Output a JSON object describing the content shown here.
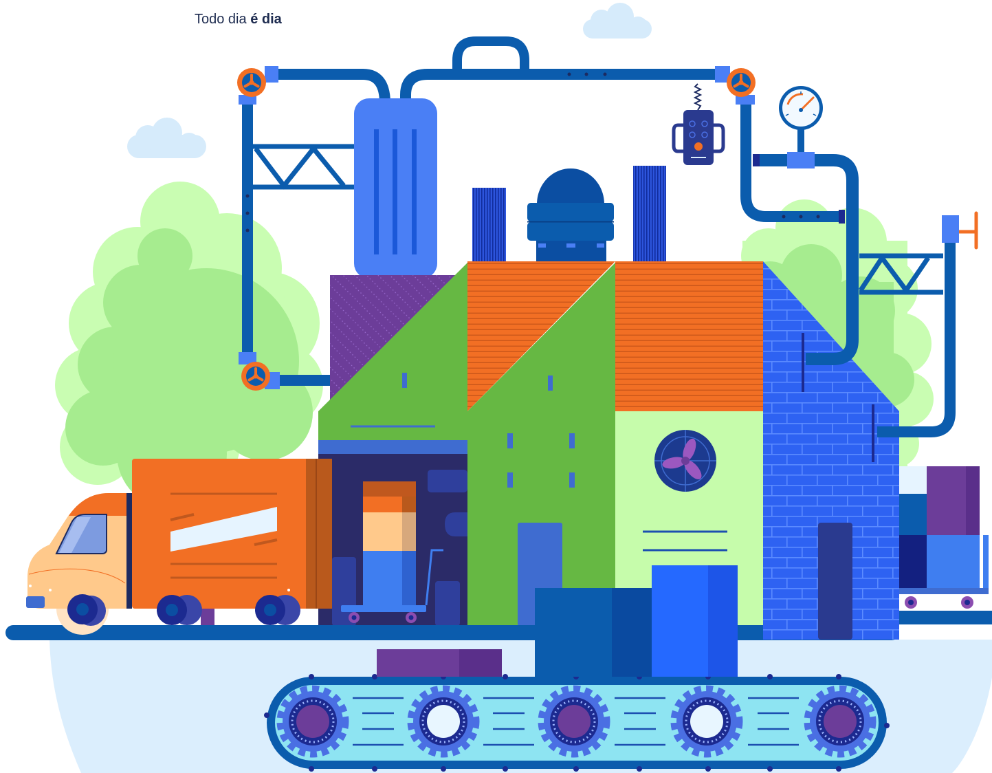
{
  "headline": {
    "regular": "Todo dia",
    "bold": "é dia"
  },
  "colors": {
    "pipe_blue": "#0b5cad",
    "accent_orange": "#f26f24",
    "building_green": "#66b843",
    "light_green": "#c6fcab",
    "purple": "#6c3d99",
    "brick_blue": "#2e62f2",
    "ground_blue": "#dbeefd",
    "text": "#1d2b4f"
  },
  "icons": [
    "valve-icon",
    "pressure-gauge-icon",
    "robot-claw-icon",
    "fan-icon",
    "gear-icon",
    "truck-icon",
    "cloud-icon",
    "tree-icon"
  ]
}
